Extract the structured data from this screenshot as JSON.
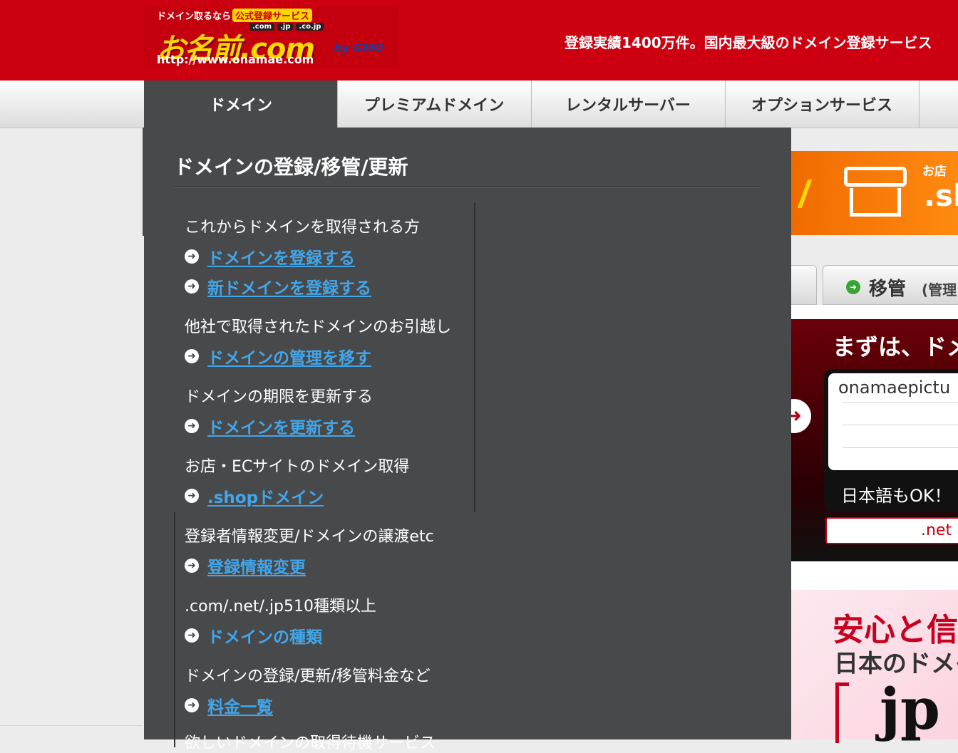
{
  "header": {
    "logo": {
      "tagline": "ドメイン取るなら",
      "badge": "公式登録サービス",
      "tlds": [
        ".com",
        ".jp",
        ".co.jp"
      ],
      "brand": "お名前.com",
      "url": "http://www.onamae.com",
      "by": "by GMO"
    },
    "catchphrase": "登録実績1400万件。国内最大級のドメイン登録サービス"
  },
  "nav": {
    "tabs": [
      {
        "label": "ドメイン"
      },
      {
        "label": "プレミアムドメイン"
      },
      {
        "label": "レンタルサーバー"
      },
      {
        "label": "オプションサービス"
      }
    ]
  },
  "dropdown": {
    "title": "ドメインの登録/移管/更新",
    "sections": [
      {
        "heading": "これからドメインを取得される方",
        "links": [
          "ドメインを登録する",
          "新ドメインを登録する"
        ]
      },
      {
        "heading": "他社で取得されたドメインのお引越し",
        "links": [
          "ドメインの管理を移す"
        ]
      },
      {
        "heading": "ドメインの期限を更新する",
        "links": [
          "ドメインを更新する"
        ]
      },
      {
        "heading": "お店・ECサイトのドメイン取得",
        "links": [
          ".shopドメイン"
        ]
      },
      {
        "heading": "登録者情報変更/ドメインの譲渡etc",
        "links": [
          "登録情報変更"
        ]
      },
      {
        "heading": ".com/.net/.jp510種類以上",
        "links": [
          "ドメインの種類"
        ]
      },
      {
        "heading": "ドメインの登録/更新/移管料金など",
        "links": [
          "料金一覧"
        ]
      },
      {
        "heading": "欲しいドメインの取得待機サービス"
      }
    ]
  },
  "right": {
    "shop_banner": {
      "label": "お店",
      "domain": ".sh"
    },
    "tabs": {
      "transfer": "移管",
      "transfer_sub": "(管理"
    },
    "search": {
      "prompt": "まずは、ドメ",
      "input_value": "onamaepictu",
      "note": "日本語もOK！",
      "tld": ".net"
    },
    "promo": {
      "line1": "安心と信",
      "line2": "日本のドメイ",
      "line3": "jp"
    }
  },
  "colors": {
    "header_red": "#cc0010",
    "dropdown_bg": "#48494b",
    "link_blue": "#41a6ea"
  },
  "icons": {
    "link_bullet": "arrow-right-circle-icon"
  }
}
